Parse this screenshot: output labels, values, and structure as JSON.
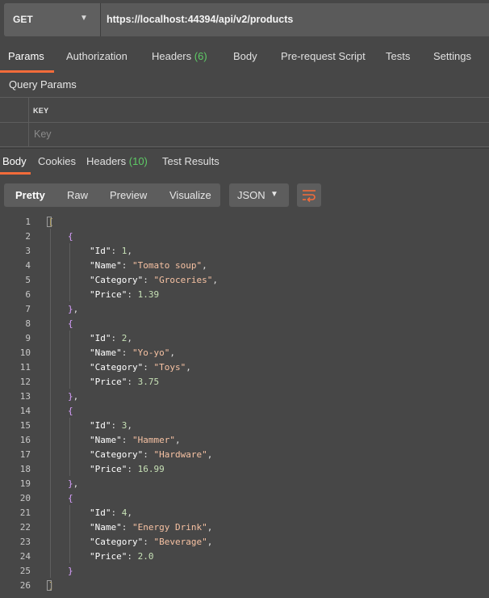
{
  "request": {
    "method": "GET",
    "url": "https://localhost:44394/api/v2/products"
  },
  "request_tabs": {
    "params": "Params",
    "authorization": "Authorization",
    "headers": "Headers",
    "headers_count": "(6)",
    "body": "Body",
    "pre_request": "Pre-request Script",
    "tests": "Tests",
    "settings": "Settings"
  },
  "query_params": {
    "title": "Query Params",
    "key_header": "KEY",
    "key_placeholder": "Key"
  },
  "response_tabs": {
    "body": "Body",
    "cookies": "Cookies",
    "headers": "Headers",
    "headers_count": "(10)",
    "test_results": "Test Results"
  },
  "view": {
    "pretty": "Pretty",
    "raw": "Raw",
    "preview": "Preview",
    "visualize": "Visualize",
    "format": "JSON"
  },
  "products": [
    {
      "Id": "1",
      "Name": "\"Tomato soup\"",
      "Category": "\"Groceries\"",
      "Price": "1.39"
    },
    {
      "Id": "2",
      "Name": "\"Yo-yo\"",
      "Category": "\"Toys\"",
      "Price": "3.75"
    },
    {
      "Id": "3",
      "Name": "\"Hammer\"",
      "Category": "\"Hardware\"",
      "Price": "16.99"
    },
    {
      "Id": "4",
      "Name": "\"Energy Drink\"",
      "Category": "\"Beverage\"",
      "Price": "2.0"
    }
  ],
  "json_keys": {
    "id": "\"Id\"",
    "name": "\"Name\"",
    "category": "\"Category\"",
    "price": "\"Price\""
  },
  "line_numbers": [
    "1",
    "2",
    "3",
    "4",
    "5",
    "6",
    "7",
    "8",
    "9",
    "10",
    "11",
    "12",
    "13",
    "14",
    "15",
    "16",
    "17",
    "18",
    "19",
    "20",
    "21",
    "22",
    "23",
    "24",
    "25",
    "26"
  ],
  "colors": {
    "accent": "#f26b3a",
    "count_green": "#5ecb66",
    "background": "#474747"
  }
}
